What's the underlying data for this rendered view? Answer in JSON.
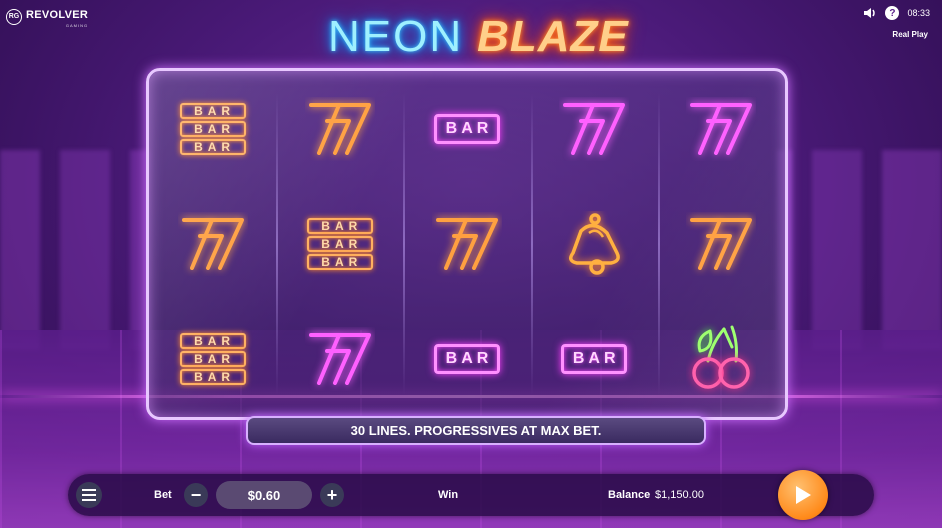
{
  "brand": {
    "badge": "RG",
    "name": "REVOLVER",
    "sub": "GAMING"
  },
  "title": {
    "part1": "NEON",
    "part2": "BLAZE"
  },
  "status": {
    "time": "08:33",
    "mode": "Real Play",
    "help": "?"
  },
  "reels": [
    [
      "bar3",
      "seven-orange",
      "bar3"
    ],
    [
      "seven-orange",
      "bar3",
      "seven-pink"
    ],
    [
      "bar-pink",
      "seven-orange",
      "bar-pink"
    ],
    [
      "seven-pink",
      "bell",
      "bar-pink"
    ],
    [
      "seven-pink",
      "seven-orange",
      "cherry"
    ]
  ],
  "symbol_text": {
    "bar": "BAR"
  },
  "banner": {
    "text": "30 LINES. PROGRESSIVES AT MAX BET."
  },
  "controls": {
    "bet_label": "Bet",
    "minus": "−",
    "bet_value": "$0.60",
    "plus": "+",
    "win_label": "Win",
    "win_value": "",
    "balance_label": "Balance",
    "balance_value": "$1,150.00"
  },
  "colors": {
    "orange_neon": "#ff8a2a",
    "pink_neon": "#ff40ff",
    "title_blue": "#3cc8ff",
    "spin_button": "#ff8a1a"
  }
}
